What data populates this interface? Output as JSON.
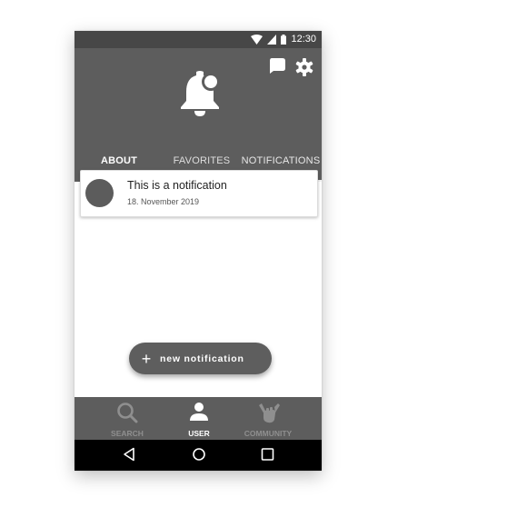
{
  "status_bar": {
    "time": "12:30"
  },
  "header": {
    "tabs": [
      {
        "label": "ABOUT"
      },
      {
        "label": "FAVORITES"
      },
      {
        "label": "NOTIFICATIONS",
        "active": true
      }
    ]
  },
  "notifications": [
    {
      "title": "This is a notification",
      "date": "18. November 2019"
    }
  ],
  "fab": {
    "label": "new notification"
  },
  "bottom_nav": {
    "items": [
      {
        "label": "SEARCH",
        "icon": "search-icon"
      },
      {
        "label": "USER",
        "icon": "user-icon",
        "active": true
      },
      {
        "label": "COMMUNITY",
        "icon": "hand-icon"
      }
    ]
  },
  "colors": {
    "header": "#5d5d5d",
    "status_bar": "#474747",
    "system_nav": "#000000",
    "fab": "#5e5e5e"
  }
}
